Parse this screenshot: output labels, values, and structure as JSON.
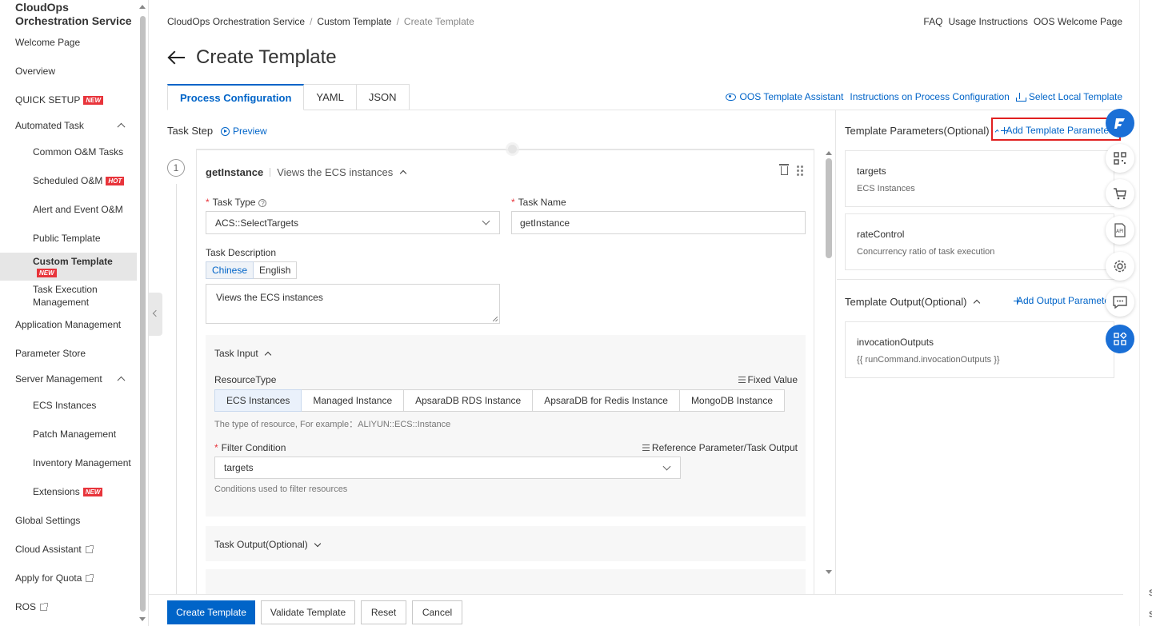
{
  "sidebar": {
    "title": "CloudOps Orchestration Service",
    "items": [
      {
        "label": "Welcome Page"
      },
      {
        "label": "Overview"
      },
      {
        "label": "QUICK SETUP",
        "badge": "NEW"
      },
      {
        "label": "Automated Task"
      },
      {
        "label": "Common O&M Tasks"
      },
      {
        "label": "Scheduled O&M",
        "badge": "HOT"
      },
      {
        "label": "Alert and Event O&M"
      },
      {
        "label": "Public Template"
      },
      {
        "label": "Custom Template",
        "badge": "NEW"
      },
      {
        "label": "Task Execution Management"
      },
      {
        "label": "Application Management"
      },
      {
        "label": "Parameter Store"
      },
      {
        "label": "Server Management"
      },
      {
        "label": "ECS Instances"
      },
      {
        "label": "Patch Management"
      },
      {
        "label": "Inventory Management"
      },
      {
        "label": "Extensions",
        "badge": "NEW"
      },
      {
        "label": "Global Settings"
      },
      {
        "label": "Cloud Assistant"
      },
      {
        "label": "Apply for Quota"
      },
      {
        "label": "ROS"
      }
    ]
  },
  "header": {
    "breadcrumb": [
      "CloudOps Orchestration Service",
      "Custom Template",
      "Create Template"
    ],
    "links": [
      "FAQ",
      "Usage Instructions",
      "OOS Welcome Page"
    ],
    "title": "Create Template"
  },
  "tabs": [
    "Process Configuration",
    "YAML",
    "JSON"
  ],
  "toolbar": {
    "assistant": "OOS Template Assistant",
    "instructions": "Instructions on Process Configuration",
    "select_local": "Select Local Template"
  },
  "editor": {
    "task_step_label": "Task Step",
    "preview": "Preview",
    "step_number": "1",
    "step_name": "getInstance",
    "step_desc": "Views the ECS instances",
    "task_type_label": "Task Type",
    "task_type_value": "ACS::SelectTargets",
    "task_name_label": "Task Name",
    "task_name_value": "getInstance",
    "task_desc_label": "Task Description",
    "lang_options": [
      "Chinese",
      "English"
    ],
    "task_desc_value": "Views the ECS instances",
    "task_input_title": "Task Input",
    "resource_type_label": "ResourceType",
    "fixed_value": "Fixed Value",
    "resource_types": [
      "ECS Instances",
      "Managed Instance",
      "ApsaraDB RDS Instance",
      "ApsaraDB for Redis Instance",
      "MongoDB Instance"
    ],
    "resource_hint": "The type of resource, For example：ALIYUN::ECS::Instance",
    "filter_label": "Filter Condition",
    "ref_param": "Reference Parameter/Task Output",
    "filter_value": "targets",
    "filter_hint": "Conditions used to filter resources",
    "task_output_title": "Task Output(Optional)"
  },
  "right_panel": {
    "params_title": "Template Parameters(Optional)",
    "add_param": "Add Template Parameter",
    "params": [
      {
        "name": "targets",
        "desc": "ECS Instances"
      },
      {
        "name": "rateControl",
        "desc": "Concurrency ratio of task execution"
      }
    ],
    "output_title": "Template Output(Optional)",
    "add_output": "Add Output Parameter",
    "outputs": [
      {
        "name": "invocationOutputs",
        "value": "{{ runCommand.invocationOutputs }}"
      }
    ]
  },
  "footer": {
    "create": "Create Template",
    "validate": "Validate Template",
    "reset": "Reset",
    "cancel": "Cancel"
  },
  "float_toolbar": [
    "assistant-logo-icon",
    "qr-code-icon",
    "cart-icon",
    "api-icon",
    "settings-icon",
    "feedback-icon",
    "apps-icon"
  ],
  "edge_marks": [
    "S",
    "S"
  ]
}
